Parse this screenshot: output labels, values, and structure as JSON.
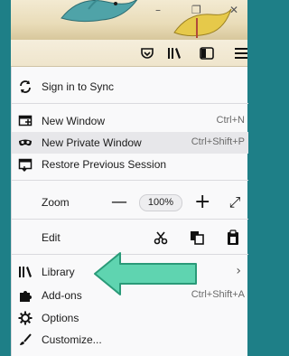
{
  "window": {
    "minimize_glyph": "–",
    "restore_glyph": "❐",
    "close_glyph": "✕"
  },
  "menu": {
    "sync_label": "Sign in to Sync",
    "new_window": {
      "label": "New Window",
      "shortcut": "Ctrl+N"
    },
    "new_private_window": {
      "label": "New Private Window",
      "shortcut": "Ctrl+Shift+P"
    },
    "restore_session": {
      "label": "Restore Previous Session"
    },
    "zoom": {
      "label": "Zoom",
      "minus": "—",
      "value": "100%",
      "plus": "+",
      "fullscreen": "⤢"
    },
    "edit": {
      "label": "Edit"
    },
    "library": {
      "label": "Library",
      "chevron": "›"
    },
    "addons": {
      "label": "Add-ons",
      "shortcut": "Ctrl+Shift+A"
    },
    "options": {
      "label": "Options"
    },
    "customize": {
      "label": "Customize..."
    }
  },
  "colors": {
    "background_teal": "#1e7f87",
    "arrow_green": "#5fd4b0",
    "arrow_outline": "#2a9a78"
  }
}
